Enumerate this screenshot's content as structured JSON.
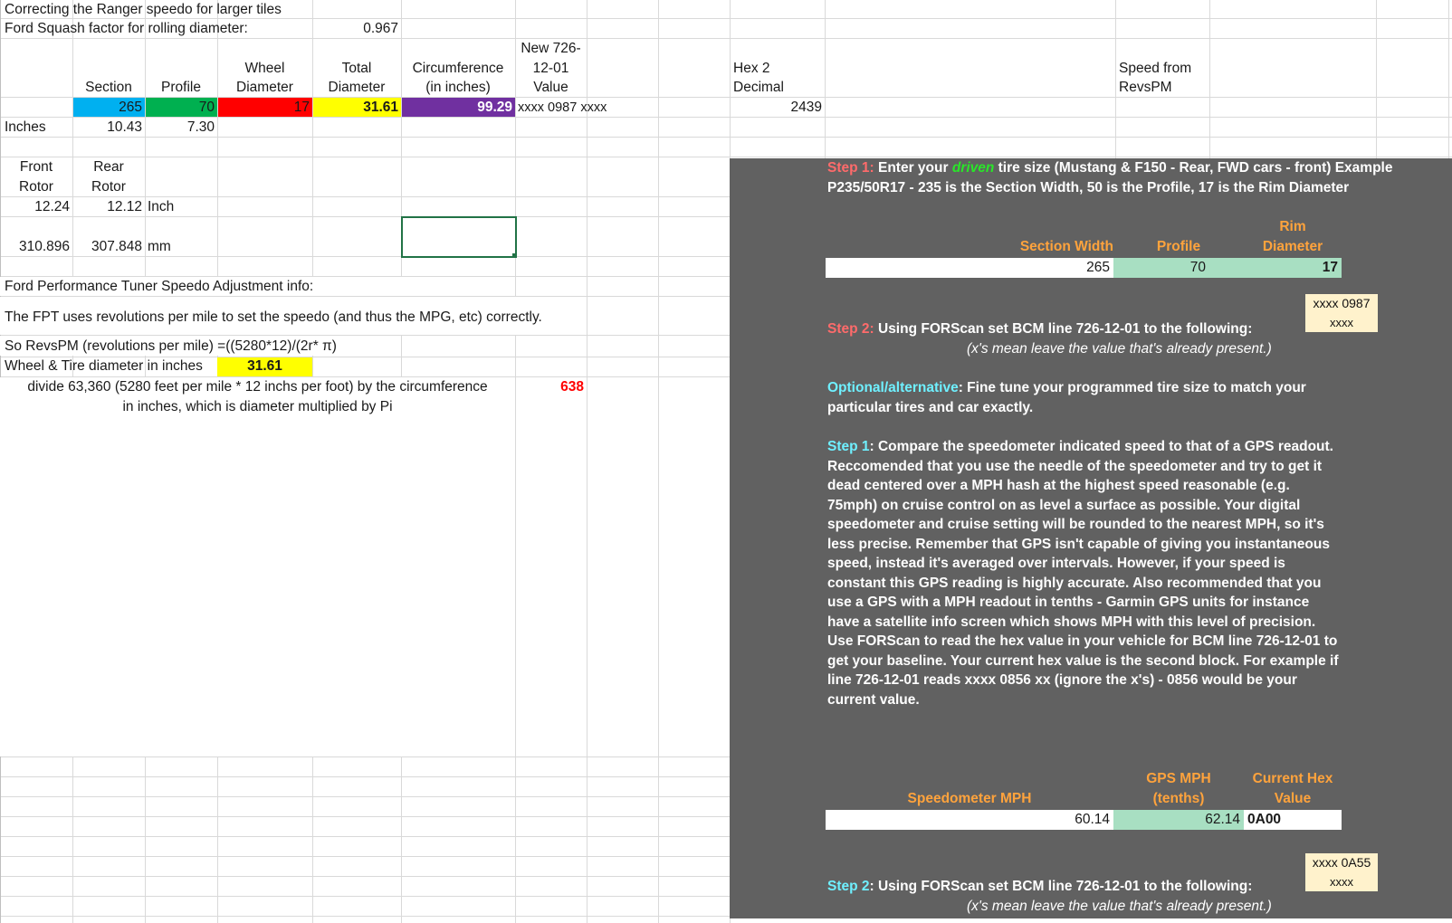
{
  "sheet": {
    "title": "Correcting the Ranger speedo for larger tiles",
    "squash_label": "Ford Squash factor for rolling diameter:",
    "squash_value": "0.967",
    "headers": {
      "section": "Section",
      "profile": "Profile",
      "wheel1": "Wheel",
      "wheel2": "Diameter",
      "total1": "Total",
      "total2": "Diameter",
      "circ1": "Circumference",
      "circ2": "(in inches)",
      "new1": "New 726-",
      "new2": "12-01",
      "new3": "Value",
      "hex1": "Hex 2",
      "hex2": "Decimal",
      "speed1": "Speed from",
      "speed2": "RevsPM"
    },
    "values": {
      "section": "265",
      "profile": "70",
      "wheel": "17",
      "total": "31.61",
      "circ": "99.29",
      "newval": "xxxx 0987 xxxx",
      "hexdec": "2439"
    },
    "inches_label": "Inches",
    "inches_section": "10.43",
    "inches_profile": "7.30",
    "front1": "Front",
    "front2": "Rotor",
    "rear1": "Rear",
    "rear2": "Rotor",
    "front_in": "12.24",
    "rear_in": "12.12",
    "inch_unit": "Inch",
    "front_mm": "310.896",
    "rear_mm": "307.848",
    "mm_unit": "mm",
    "fpt_title": "Ford Performance Tuner Speedo Adjustment info:",
    "fpt_desc": "The FPT uses revolutions per mile to set the speedo (and thus the MPG, etc) correctly.",
    "revspm_formula": "So RevsPM (revolutions per mile) =((5280*12)/(2r* π)",
    "wheel_tire_label": "Wheel & Tire diameter in inches",
    "wheel_tire_value": "31.61",
    "divide_line1": "divide 63,360 (5280 feet per mile * 12 inchs per foot) by the circumference",
    "divide_line2": "in inches, which is diameter multiplied by Pi",
    "revspm_value": "638"
  },
  "panel": {
    "step1_label": "Step 1:",
    "step1_text_a": " Enter your ",
    "step1_driven": "driven",
    "step1_text_b": " tire size (Mustang & F150 - Rear, FWD cars - front) Example",
    "step1_line2": "P235/50R17 - 235 is the Section Width, 50 is the Profile, 17 is the Rim Diameter",
    "hdr_section": "Section Width",
    "hdr_profile": "Profile",
    "hdr_rim1": "Rim",
    "hdr_rim2": "Diameter",
    "in_section": "265",
    "in_profile": "70",
    "in_rim": "17",
    "box1_line1": "xxxx 0987",
    "box1_line2": "xxxx",
    "step2_label": "Step 2:",
    "step2_text": " Using FORScan set BCM line 726-12-01 to the following:",
    "step2_note": "(x's mean leave the value that's already present.)",
    "opt_label": "Optional/alternative",
    "opt_text": ": Fine tune your programmed tire size to match your",
    "opt_line2": "particular tires and car exactly.",
    "alt_step1_label": "Step 1",
    "alt_step1_lines": [
      ": Compare the speedometer indicated speed to that of a GPS readout.",
      "Reccomended that you use the needle of the speedometer and try to get it",
      "dead centered over a MPH hash at the highest speed reasonable (e.g.",
      "75mph) on cruise control on as level a surface as possible. Your digital",
      "speedometer and cruise setting will be rounded to the nearest MPH, so it's",
      "less precise. Remember that GPS isn't capable of giving you instantaneous",
      "speed, instead it's averaged over intervals. However, if your speed is",
      "constant this GPS reading is highly accurate. Also recommended that you",
      "use a GPS with a MPH readout in tenths - Garmin GPS units for instance",
      "have a satellite info screen which shows MPH with this level of precision.",
      "Use FORScan to read the hex value in your vehicle for BCM line 726-12-01 to",
      "get your baseline. Your current hex value is the second block. For example if",
      "line 726-12-01 reads xxxx 0856 xx (ignore the x's) - 0856 would be your",
      "current value."
    ],
    "hdr_speedo": "Speedometer MPH",
    "hdr_gps1": "GPS MPH",
    "hdr_gps2": "(tenths)",
    "hdr_hex1": "Current Hex",
    "hdr_hex2": "Value",
    "in_speedo": "60.14",
    "in_gps": "62.14",
    "in_hex": "0A00",
    "box2_line1": "xxxx 0A55",
    "box2_line2": "xxxx",
    "alt_step2_label": "Step 2",
    "alt_step2_text": ": Using FORScan set BCM line 726-12-01 to the following:",
    "alt_step2_note": "(x's mean leave the value that's already present.)"
  },
  "colors": {
    "section_fill": "#00b0f0",
    "profile_fill": "#00b050",
    "wheel_fill": "#ff0000",
    "total_fill": "#ffff00",
    "circ_fill": "#7030a0",
    "panel_bg": "#616161"
  }
}
